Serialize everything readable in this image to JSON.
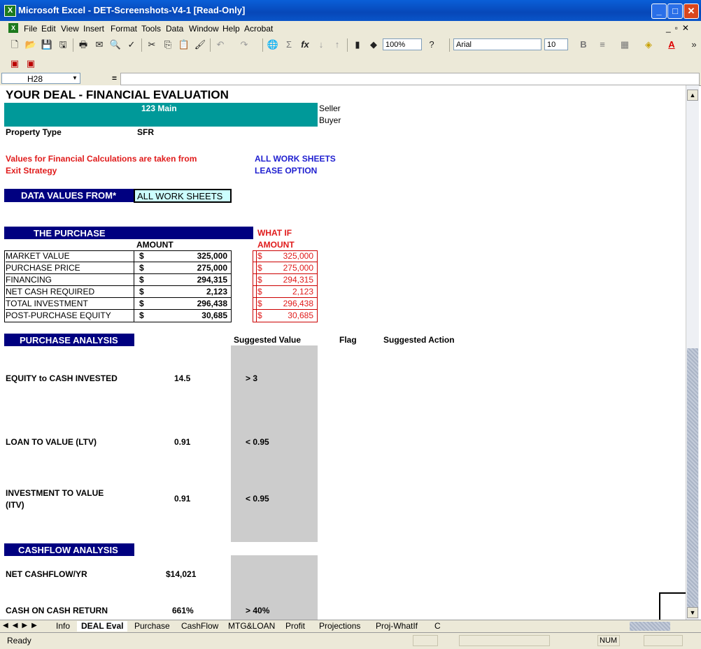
{
  "window": {
    "title": "Microsoft Excel - DET-Screenshots-V4-1  [Read-Only]"
  },
  "menu": [
    "File",
    "Edit",
    "View",
    "Insert",
    "Format",
    "Tools",
    "Data",
    "Window",
    "Help",
    "Acrobat"
  ],
  "toolbar": {
    "zoom": "100%",
    "font": "Arial",
    "size": "10",
    "bold": "B"
  },
  "formula_bar": {
    "name_box": "H28",
    "equals": "="
  },
  "sheet": {
    "title": "YOUR DEAL - FINANCIAL EVALUATION",
    "address": "123 Main",
    "seller": "Seller",
    "buyer": "Buyer",
    "property_type_label": "Property Type",
    "property_type_value": "SFR",
    "note_line1": "Values for Financial Calculations are taken from",
    "note_line2": "Exit Strategy",
    "source_line1": "ALL WORK SHEETS",
    "source_line2": "LEASE OPTION",
    "data_values_label": "DATA VALUES FROM*",
    "data_values_select": "ALL WORK SHEETS",
    "purchase_header": "THE PURCHASE",
    "amount_header": "AMOUNT",
    "whatif_header1": "WHAT IF",
    "whatif_header2": "AMOUNT",
    "purchase_rows": [
      {
        "label": "MARKET VALUE",
        "cur": "$",
        "amount": "325,000",
        "whatif": "325,000"
      },
      {
        "label": "PURCHASE PRICE",
        "cur": "$",
        "amount": "275,000",
        "whatif": "275,000"
      },
      {
        "label": "FINANCING",
        "cur": "$",
        "amount": "294,315",
        "whatif": "294,315"
      },
      {
        "label": "NET CASH REQUIRED",
        "cur": "$",
        "amount": "2,123",
        "whatif": "2,123"
      },
      {
        "label": "TOTAL INVESTMENT",
        "cur": "$",
        "amount": "296,438",
        "whatif": "296,438"
      },
      {
        "label": "POST-PURCHASE EQUITY",
        "cur": "$",
        "amount": "30,685",
        "whatif": "30,685"
      }
    ],
    "analysis_header": "PURCHASE ANALYSIS",
    "col_suggested": "Suggested Value",
    "col_flag": "Flag",
    "col_action": "Suggested Action",
    "metrics": [
      {
        "label": "EQUITY to CASH INVESTED",
        "value": "14.5",
        "suggested": "> 3"
      },
      {
        "label": "LOAN TO VALUE (LTV)",
        "value": "0.91",
        "suggested": "< 0.95"
      },
      {
        "label1": "INVESTMENT TO VALUE",
        "label2": "(ITV)",
        "value": "0.91",
        "suggested": "< 0.95"
      }
    ],
    "cashflow_header": "CASHFLOW ANALYSIS",
    "cashflow": [
      {
        "label": "NET CASHFLOW/YR",
        "value": "$14,021",
        "suggested": ""
      },
      {
        "label": "CASH ON CASH RETURN",
        "value": "661%",
        "suggested": "> 40%"
      }
    ]
  },
  "tabs": [
    "Info",
    "DEAL Eval",
    "Purchase",
    "CashFlow",
    "MTG&LOAN",
    "Profit",
    "Projections",
    "Proj-WhatIf",
    "C"
  ],
  "status": {
    "ready": "Ready",
    "num": "NUM"
  },
  "colors": {
    "navy": "#000080",
    "teal": "#009999",
    "red": "#e01b1b",
    "blue": "#1f1fd0",
    "grey": "#cccccc"
  }
}
